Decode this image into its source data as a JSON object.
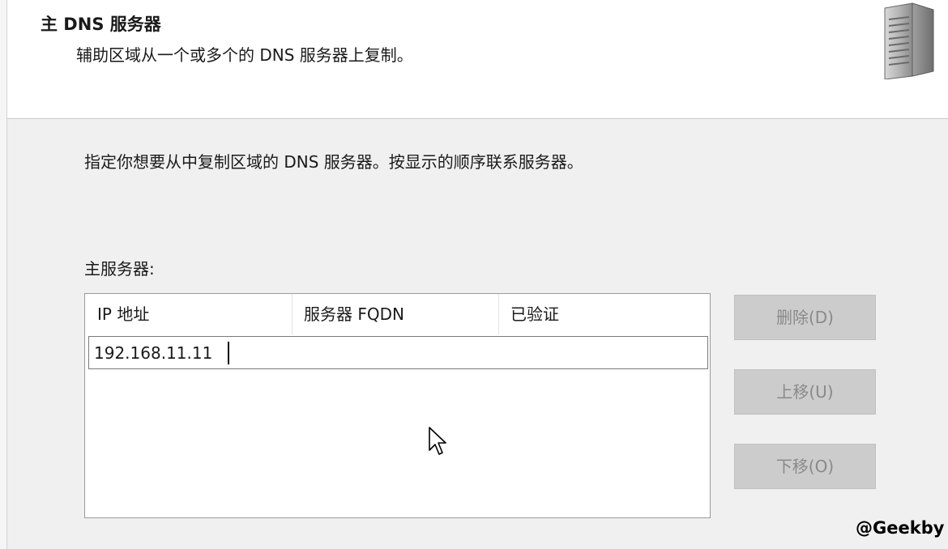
{
  "header": {
    "title": "主 DNS 服务器",
    "subtitle": "辅助区域从一个或多个的 DNS 服务器上复制。",
    "icon": "server-tower-icon"
  },
  "instruction": "指定你想要从中复制区域的 DNS 服务器。按显示的顺序联系服务器。",
  "master_servers": {
    "label": "主服务器:",
    "columns": [
      "IP 地址",
      "服务器 FQDN",
      "已验证"
    ],
    "editing_value": "192.168.11.11"
  },
  "buttons": {
    "delete": "删除(D)",
    "move_up": "上移(U)",
    "move_down": "下移(O)"
  },
  "watermark": "@Geekby",
  "colors": {
    "disabled_button_bg": "#cccccc",
    "disabled_button_text": "#8a8a8a",
    "header_bg": "#ffffff",
    "page_bg": "#f0f0f0"
  }
}
